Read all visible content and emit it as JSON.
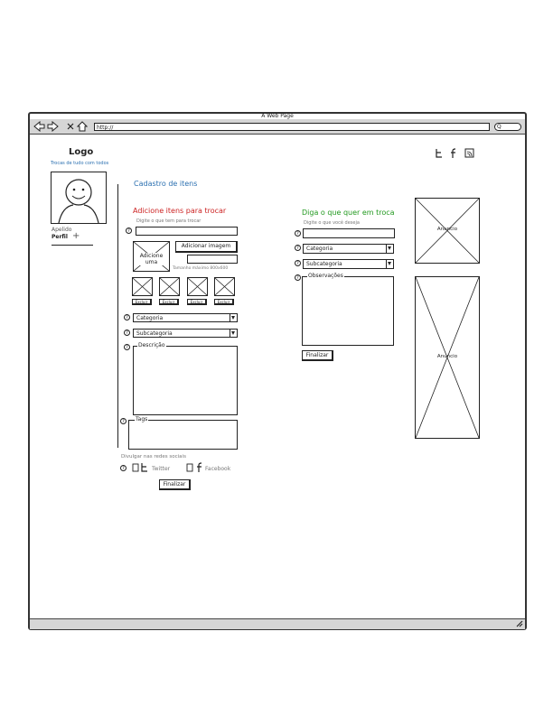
{
  "browser": {
    "title": "A Web Page",
    "url": "http://",
    "search_icon_glyph": "Q"
  },
  "header": {
    "logo": "Logo",
    "tagline": "Trocas de tudo com todos",
    "social_icons": [
      "twitter-icon",
      "facebook-icon",
      "rss-icon"
    ]
  },
  "profile": {
    "nickname": "Apelido",
    "profile_label": "Perfil",
    "plus_glyph": "+"
  },
  "page": {
    "section_title": "Cadastro de itens"
  },
  "add_items": {
    "heading": "Adicione itens para trocar",
    "heading_color": "#cc2222",
    "hint": "Digite o que tem para trocar",
    "add_one": "Adicione uma",
    "add_image_button": "Adicionar imagem",
    "size_hint": "Tamanho máximo 800x600",
    "thumb_buttons": [
      "Excluir",
      "Excluir",
      "Excluir",
      "Excluir"
    ],
    "category_label": "Categoria",
    "subcategory_label": "Subcategoria",
    "description_label": "Descrição",
    "tags_label": "Tags",
    "share_label": "Divulgar nas redes sociais",
    "twitter_label": "Twitter",
    "facebook_label": "Facebook",
    "finish_button": "Finalizar",
    "help_glyph": "?"
  },
  "wants": {
    "heading": "Diga o que quer em troca",
    "heading_color": "#22991f",
    "hint": "Digite o que você deseja",
    "category_label": "Categoria",
    "subcategory_label": "Subcategoria",
    "observations_label": "Observações",
    "finish_button": "Finalizar"
  },
  "ads": {
    "ad_top_label": "Anuncio",
    "ad_bottom_label": "Anuncio"
  },
  "colors": {
    "link_blue": "#2a6fb0",
    "chrome_gray": "#d6d6d6"
  }
}
